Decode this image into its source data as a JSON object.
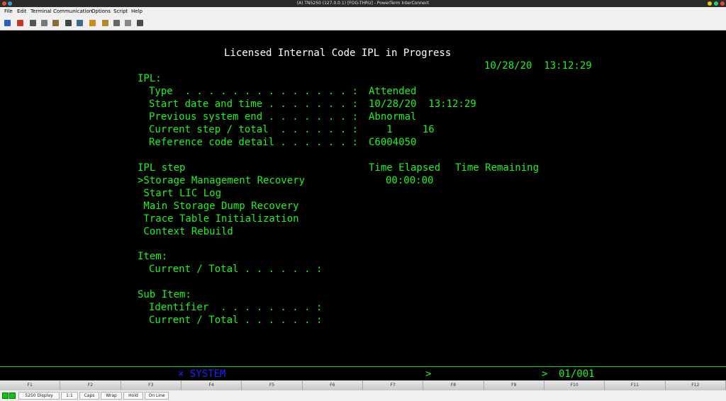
{
  "window": {
    "title": "(A) TN5250 (127.0.0.1) [FOG-THRU] - PowerTerm InterConnect"
  },
  "menu": [
    "File",
    "Edit",
    "Terminal",
    "Communication",
    "Options",
    "Script",
    "Help"
  ],
  "toolbar": {
    "icons": [
      "connect-icon",
      "disconnect-icon",
      "cut-icon",
      "copy-icon",
      "paste-icon",
      "print-icon",
      "print-screen-icon",
      "palette-icon",
      "tools-icon",
      "keyboard-icon",
      "grid-icon",
      "macro-icon"
    ]
  },
  "terminal": {
    "title": "Licensed Internal Code IPL in Progress",
    "datetime": "10/28/20  13:12:29",
    "ipl_heading": "IPL:",
    "fields": [
      {
        "label": "Type  . . . . . . . . . . . . . . :",
        "value": "Attended"
      },
      {
        "label": "Start date and time . . . . . . . :",
        "value": "10/28/20  13:12:29"
      },
      {
        "label": "Previous system end . . . . . . . :",
        "value": "Abnormal"
      },
      {
        "label": "Current step / total  . . . . . . :",
        "value": "   1     16"
      },
      {
        "label": "Reference code detail . . . . . . :",
        "value": "C6004050"
      }
    ],
    "step_header": {
      "label": "IPL step",
      "elapsed": "Time Elapsed",
      "remaining": "Time Remaining"
    },
    "steps": [
      {
        "label": ">Storage Management Recovery",
        "elapsed": "00:00:00"
      },
      {
        "label": " Start LIC Log",
        "elapsed": ""
      },
      {
        "label": " Main Storage Dump Recovery",
        "elapsed": ""
      },
      {
        "label": " Trace Table Initialization",
        "elapsed": ""
      },
      {
        "label": " Context Rebuild",
        "elapsed": ""
      }
    ],
    "item": {
      "heading": "Item:",
      "current_total": "Current / Total . . . . . . :"
    },
    "sub_item": {
      "heading": "Sub Item:",
      "identifier": "Identifier  . . . . . . . . :",
      "current_total": "Current / Total . . . . . . :"
    }
  },
  "status_line": {
    "system": "× SYSTEM",
    "arrow1": ">",
    "arrow2": ">",
    "page": "01/001"
  },
  "fkeys": [
    "F1",
    "F2",
    "F3",
    "F4",
    "F5",
    "F6",
    "F7",
    "F8",
    "F9",
    "F10",
    "F11",
    "F12"
  ],
  "bottom": {
    "display": "5250 Display",
    "ratio": "1:1",
    "caps": "Caps",
    "wrap": "Wrap",
    "hold": "Hold",
    "online": "On Line"
  },
  "colors": {
    "terminal_green": "#22f022",
    "status_blue": "#2020ff",
    "background": "#000000"
  }
}
